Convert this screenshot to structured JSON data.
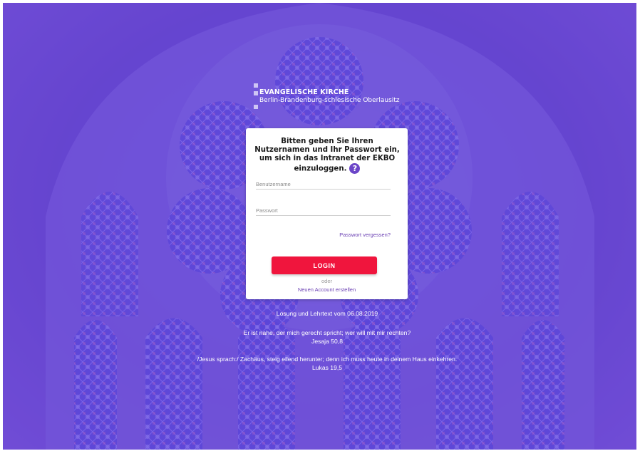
{
  "logo": {
    "line1": "EVANGELISCHE KIRCHE",
    "line2": "Berlin-Brandenburg-schlesische Oberlausitz"
  },
  "login": {
    "intro": "Bitten geben Sie Ihren Nutzernamen und Ihr Passwort ein, um sich in das Intranet der EKBO einzuloggen.",
    "help_icon": "?",
    "username_placeholder": "Benutzername",
    "password_placeholder": "Passwort",
    "forgot_link": "Passwort vergessen?",
    "login_button": "LOGIN",
    "or_text": "oder",
    "create_account_link": "Neuen Account erstellen"
  },
  "losung": {
    "heading": "Losung und Lehrtext vom 06.08.2019",
    "verse1": "Er ist nahe, der mich gerecht spricht; wer will mit mir rechten?",
    "ref1": "Jesaja 50,8",
    "verse2": "/Jesus sprach:/ Zachäus, steig eilend herunter; denn ich muss heute in deinem Haus einkehren.",
    "ref2": "Lukas 19,5"
  },
  "colors": {
    "background": "#5b45d8",
    "accent": "#6a3fb3",
    "login_button": "#f0153d"
  }
}
